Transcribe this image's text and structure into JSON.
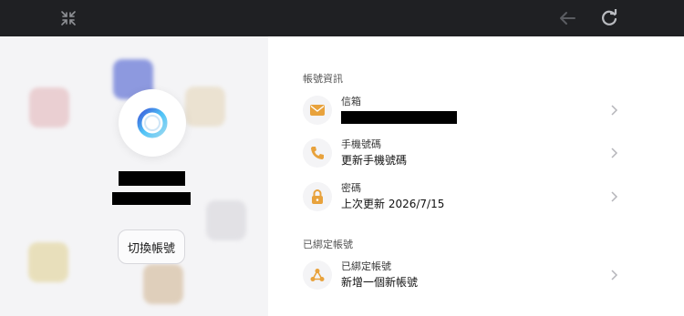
{
  "topbar": {
    "left_icon": "collapse-icon",
    "back_icon": "back-arrow-icon",
    "refresh_icon": "refresh-icon"
  },
  "left_panel": {
    "switch_account_label": "切換帳號",
    "logo_icon": "app-logo-ring-icon",
    "redacted_name": "",
    "redacted_id": ""
  },
  "right_panel": {
    "account_info_title": "帳號資訊",
    "bound_accounts_title": "已綁定帳號",
    "rows": [
      {
        "label": "信箱",
        "value": "",
        "icon": "mail-icon",
        "redacted": true
      },
      {
        "label": "手機號碼",
        "value": "更新手機號碼",
        "icon": "phone-icon"
      },
      {
        "label": "密碼",
        "value": "上次更新 2026/7/15",
        "icon": "lock-icon"
      },
      {
        "label": "已綁定帳號",
        "value": "新增一個新帳號",
        "icon": "share-icon"
      }
    ]
  },
  "colors": {
    "accent": "#e8a23c",
    "topbar": "#1f2023",
    "left_bg": "#f4f4f6"
  }
}
